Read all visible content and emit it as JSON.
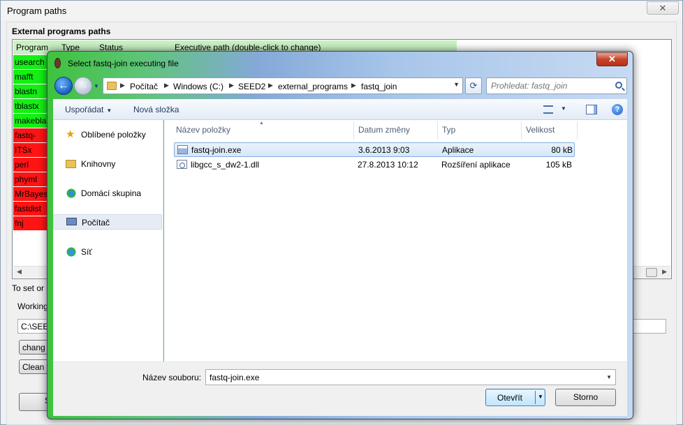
{
  "main_window": {
    "title": "Program paths",
    "close_label": "✕",
    "group_title": "External programs paths",
    "columns": [
      "Program",
      "Type",
      "Status",
      "Executive path (double-click to change)"
    ],
    "programs": [
      {
        "name": "usearch",
        "status_color": "#14f014"
      },
      {
        "name": "mafft",
        "status_color": "#14f014"
      },
      {
        "name": "blastn",
        "status_color": "#14f014"
      },
      {
        "name": "tblastx",
        "status_color": "#14f014"
      },
      {
        "name": "makeblast",
        "status_color": "#14f014"
      },
      {
        "name": "fastq-join",
        "status_color": "#ff1414"
      },
      {
        "name": "ITSx",
        "status_color": "#ff1414"
      },
      {
        "name": "perl",
        "status_color": "#ff1414"
      },
      {
        "name": "phyml",
        "status_color": "#ff1414"
      },
      {
        "name": "MrBayes",
        "status_color": "#ff1414"
      },
      {
        "name": "fastdist",
        "status_color": "#ff1414"
      },
      {
        "name": "fnj",
        "status_color": "#ff1414"
      }
    ],
    "hint_text": "To set or c",
    "working_label": "Working",
    "working_path": "C:\\SEED",
    "change_button": "chang",
    "clean_button": "Clean w",
    "bottom_button": "S"
  },
  "dialog": {
    "title": "Select fastq-join executing file",
    "close_label": "✕",
    "breadcrumbs": [
      "Počítač",
      "Windows (C:)",
      "SEED2",
      "external_programs",
      "fastq_join"
    ],
    "search_placeholder": "Prohledat: fastq_join",
    "toolbar": {
      "organize": "Uspořádat",
      "new_folder": "Nová složka"
    },
    "nav_items": [
      {
        "label": "Oblíbené položky",
        "icon": "star-icon"
      },
      {
        "label": "Knihovny",
        "icon": "library-icon"
      },
      {
        "label": "Domácí skupina",
        "icon": "homegroup-icon"
      },
      {
        "label": "Počítač",
        "icon": "computer-icon"
      },
      {
        "label": "Síť",
        "icon": "network-icon"
      }
    ],
    "columns": {
      "name": "Název položky",
      "date": "Datum změny",
      "type": "Typ",
      "size": "Velikost"
    },
    "files": [
      {
        "name": "fastq-join.exe",
        "date": "3.6.2013 9:03",
        "type": "Aplikace",
        "size": "80 kB"
      },
      {
        "name": "libgcc_s_dw2-1.dll",
        "date": "27.8.2013 10:12",
        "type": "Rozšíření aplikace",
        "size": "105 kB"
      }
    ],
    "filename_label": "Název souboru:",
    "filename_value": "fastq-join.exe",
    "open_button": "Otevřít",
    "cancel_button": "Storno"
  }
}
